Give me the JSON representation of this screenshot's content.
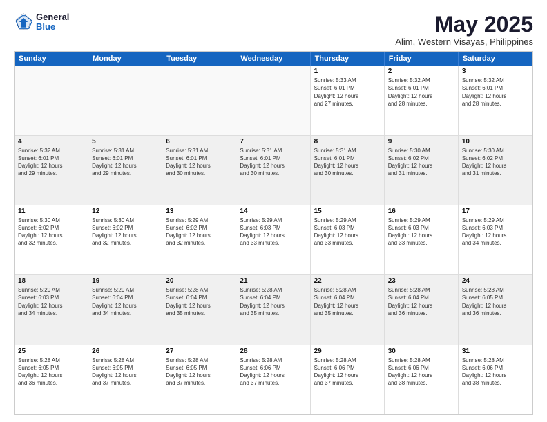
{
  "header": {
    "logo_general": "General",
    "logo_blue": "Blue",
    "title": "May 2025",
    "location": "Alim, Western Visayas, Philippines"
  },
  "calendar": {
    "days": [
      "Sunday",
      "Monday",
      "Tuesday",
      "Wednesday",
      "Thursday",
      "Friday",
      "Saturday"
    ],
    "rows": [
      [
        {
          "day": "",
          "content": ""
        },
        {
          "day": "",
          "content": ""
        },
        {
          "day": "",
          "content": ""
        },
        {
          "day": "",
          "content": ""
        },
        {
          "day": "1",
          "content": "Sunrise: 5:33 AM\nSunset: 6:01 PM\nDaylight: 12 hours\nand 27 minutes."
        },
        {
          "day": "2",
          "content": "Sunrise: 5:32 AM\nSunset: 6:01 PM\nDaylight: 12 hours\nand 28 minutes."
        },
        {
          "day": "3",
          "content": "Sunrise: 5:32 AM\nSunset: 6:01 PM\nDaylight: 12 hours\nand 28 minutes."
        }
      ],
      [
        {
          "day": "4",
          "content": "Sunrise: 5:32 AM\nSunset: 6:01 PM\nDaylight: 12 hours\nand 29 minutes."
        },
        {
          "day": "5",
          "content": "Sunrise: 5:31 AM\nSunset: 6:01 PM\nDaylight: 12 hours\nand 29 minutes."
        },
        {
          "day": "6",
          "content": "Sunrise: 5:31 AM\nSunset: 6:01 PM\nDaylight: 12 hours\nand 30 minutes."
        },
        {
          "day": "7",
          "content": "Sunrise: 5:31 AM\nSunset: 6:01 PM\nDaylight: 12 hours\nand 30 minutes."
        },
        {
          "day": "8",
          "content": "Sunrise: 5:31 AM\nSunset: 6:01 PM\nDaylight: 12 hours\nand 30 minutes."
        },
        {
          "day": "9",
          "content": "Sunrise: 5:30 AM\nSunset: 6:02 PM\nDaylight: 12 hours\nand 31 minutes."
        },
        {
          "day": "10",
          "content": "Sunrise: 5:30 AM\nSunset: 6:02 PM\nDaylight: 12 hours\nand 31 minutes."
        }
      ],
      [
        {
          "day": "11",
          "content": "Sunrise: 5:30 AM\nSunset: 6:02 PM\nDaylight: 12 hours\nand 32 minutes."
        },
        {
          "day": "12",
          "content": "Sunrise: 5:30 AM\nSunset: 6:02 PM\nDaylight: 12 hours\nand 32 minutes."
        },
        {
          "day": "13",
          "content": "Sunrise: 5:29 AM\nSunset: 6:02 PM\nDaylight: 12 hours\nand 32 minutes."
        },
        {
          "day": "14",
          "content": "Sunrise: 5:29 AM\nSunset: 6:03 PM\nDaylight: 12 hours\nand 33 minutes."
        },
        {
          "day": "15",
          "content": "Sunrise: 5:29 AM\nSunset: 6:03 PM\nDaylight: 12 hours\nand 33 minutes."
        },
        {
          "day": "16",
          "content": "Sunrise: 5:29 AM\nSunset: 6:03 PM\nDaylight: 12 hours\nand 33 minutes."
        },
        {
          "day": "17",
          "content": "Sunrise: 5:29 AM\nSunset: 6:03 PM\nDaylight: 12 hours\nand 34 minutes."
        }
      ],
      [
        {
          "day": "18",
          "content": "Sunrise: 5:29 AM\nSunset: 6:03 PM\nDaylight: 12 hours\nand 34 minutes."
        },
        {
          "day": "19",
          "content": "Sunrise: 5:29 AM\nSunset: 6:04 PM\nDaylight: 12 hours\nand 34 minutes."
        },
        {
          "day": "20",
          "content": "Sunrise: 5:28 AM\nSunset: 6:04 PM\nDaylight: 12 hours\nand 35 minutes."
        },
        {
          "day": "21",
          "content": "Sunrise: 5:28 AM\nSunset: 6:04 PM\nDaylight: 12 hours\nand 35 minutes."
        },
        {
          "day": "22",
          "content": "Sunrise: 5:28 AM\nSunset: 6:04 PM\nDaylight: 12 hours\nand 35 minutes."
        },
        {
          "day": "23",
          "content": "Sunrise: 5:28 AM\nSunset: 6:04 PM\nDaylight: 12 hours\nand 36 minutes."
        },
        {
          "day": "24",
          "content": "Sunrise: 5:28 AM\nSunset: 6:05 PM\nDaylight: 12 hours\nand 36 minutes."
        }
      ],
      [
        {
          "day": "25",
          "content": "Sunrise: 5:28 AM\nSunset: 6:05 PM\nDaylight: 12 hours\nand 36 minutes."
        },
        {
          "day": "26",
          "content": "Sunrise: 5:28 AM\nSunset: 6:05 PM\nDaylight: 12 hours\nand 37 minutes."
        },
        {
          "day": "27",
          "content": "Sunrise: 5:28 AM\nSunset: 6:05 PM\nDaylight: 12 hours\nand 37 minutes."
        },
        {
          "day": "28",
          "content": "Sunrise: 5:28 AM\nSunset: 6:06 PM\nDaylight: 12 hours\nand 37 minutes."
        },
        {
          "day": "29",
          "content": "Sunrise: 5:28 AM\nSunset: 6:06 PM\nDaylight: 12 hours\nand 37 minutes."
        },
        {
          "day": "30",
          "content": "Sunrise: 5:28 AM\nSunset: 6:06 PM\nDaylight: 12 hours\nand 38 minutes."
        },
        {
          "day": "31",
          "content": "Sunrise: 5:28 AM\nSunset: 6:06 PM\nDaylight: 12 hours\nand 38 minutes."
        }
      ]
    ]
  }
}
